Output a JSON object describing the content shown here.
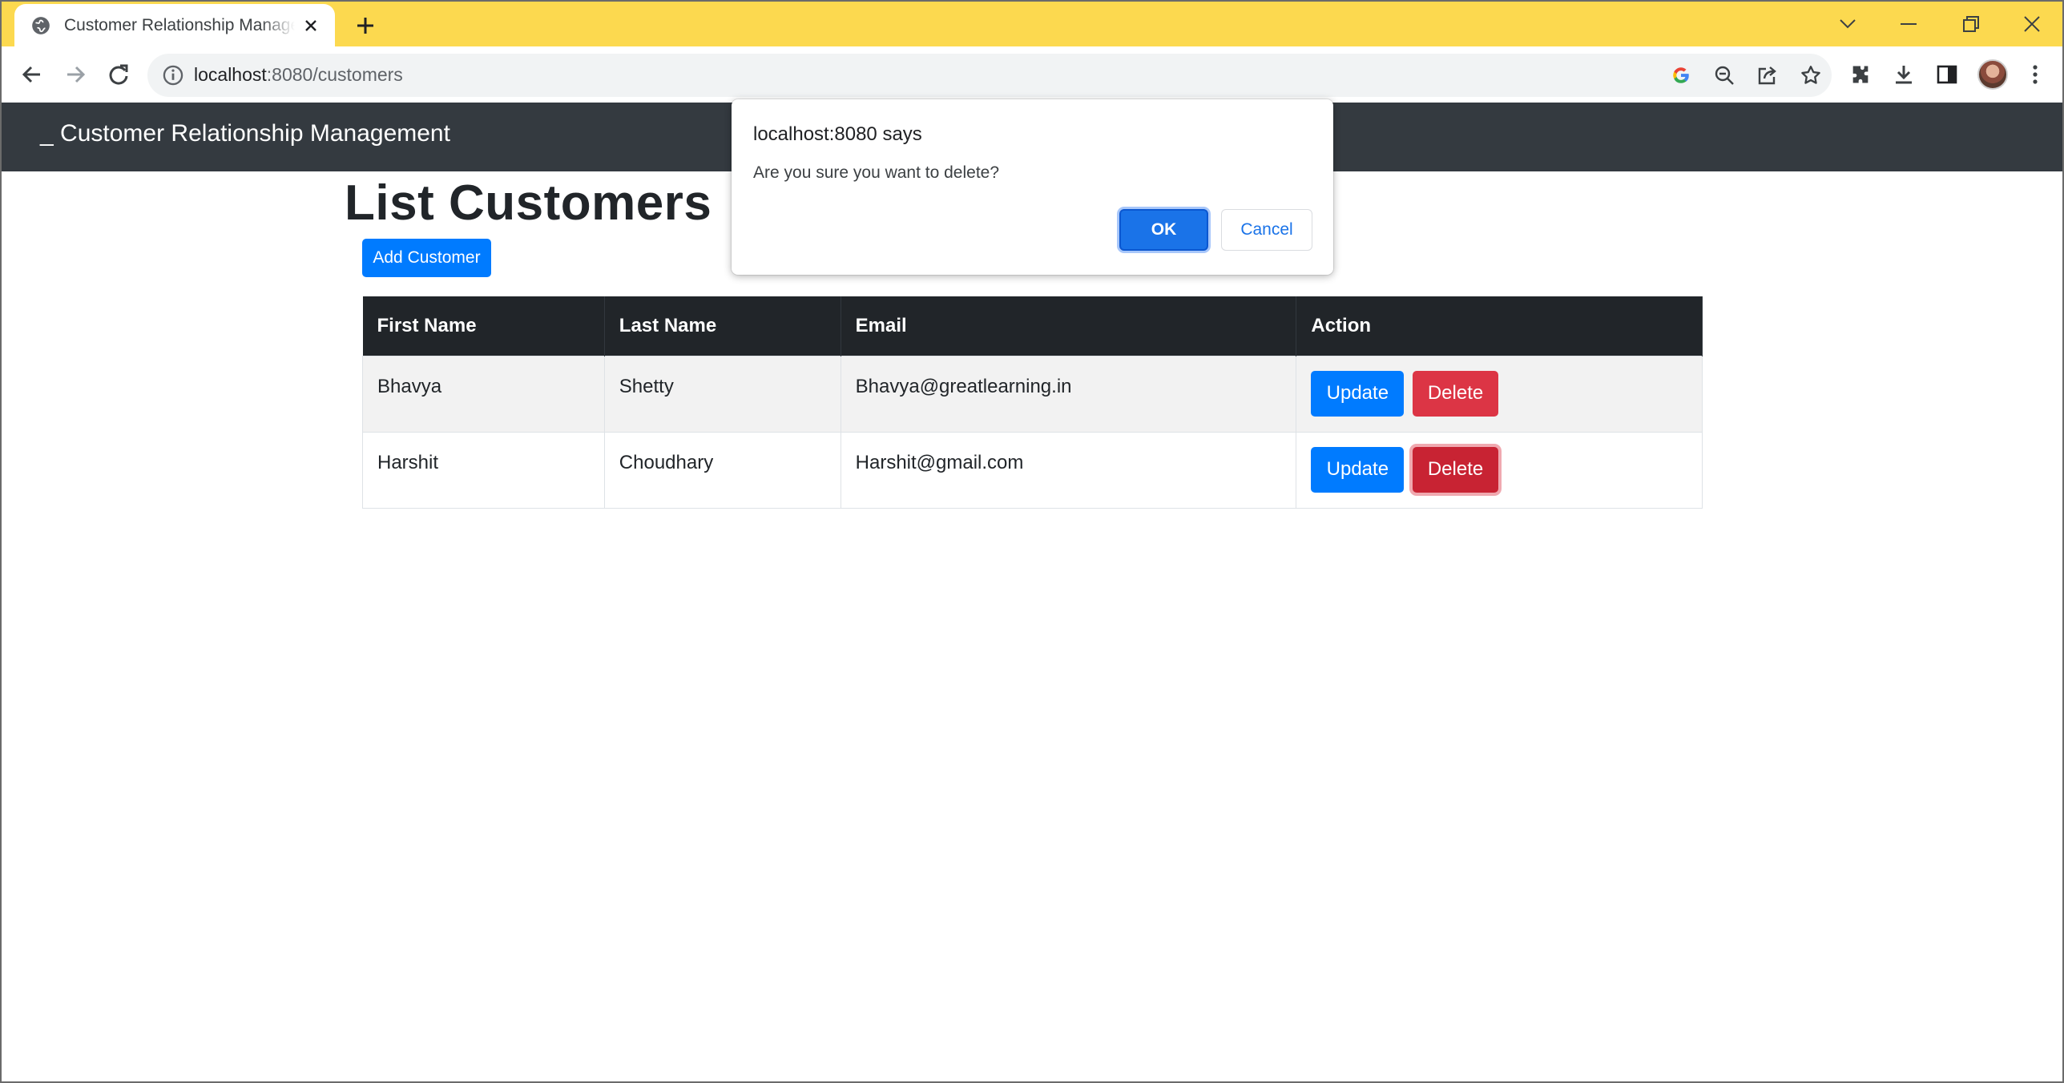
{
  "browser": {
    "tab_title": "Customer Relationship Management",
    "url_host": "localhost",
    "url_rest": ":8080/customers",
    "accent_color": "#fcd94f"
  },
  "navbar": {
    "brand_prefix": "_",
    "brand": "Customer Relationship Management"
  },
  "main": {
    "title": "List Customers",
    "add_button": "Add Customer",
    "table": {
      "headers": [
        "First Name",
        "Last Name",
        "Email",
        "Action"
      ],
      "rows": [
        {
          "first": "Bhavya",
          "last": "Shetty",
          "email": "Bhavya@greatlearning.in",
          "update": "Update",
          "delete": "Delete"
        },
        {
          "first": "Harshit",
          "last": "Choudhary",
          "email": "Harshit@gmail.com",
          "update": "Update",
          "delete": "Delete"
        }
      ]
    }
  },
  "dialog": {
    "title": "localhost:8080 says",
    "message": "Are you sure you want to delete?",
    "ok": "OK",
    "cancel": "Cancel"
  },
  "icons": {
    "tab": "globe-icon",
    "toolbar": [
      "back-arrow-icon",
      "forward-arrow-icon",
      "reload-icon",
      "info-icon",
      "google-icon",
      "zoom-out-icon",
      "share-icon",
      "star-icon",
      "extensions-icon",
      "download-icon",
      "side-panel-icon",
      "profile-avatar",
      "more-menu-icon"
    ]
  }
}
